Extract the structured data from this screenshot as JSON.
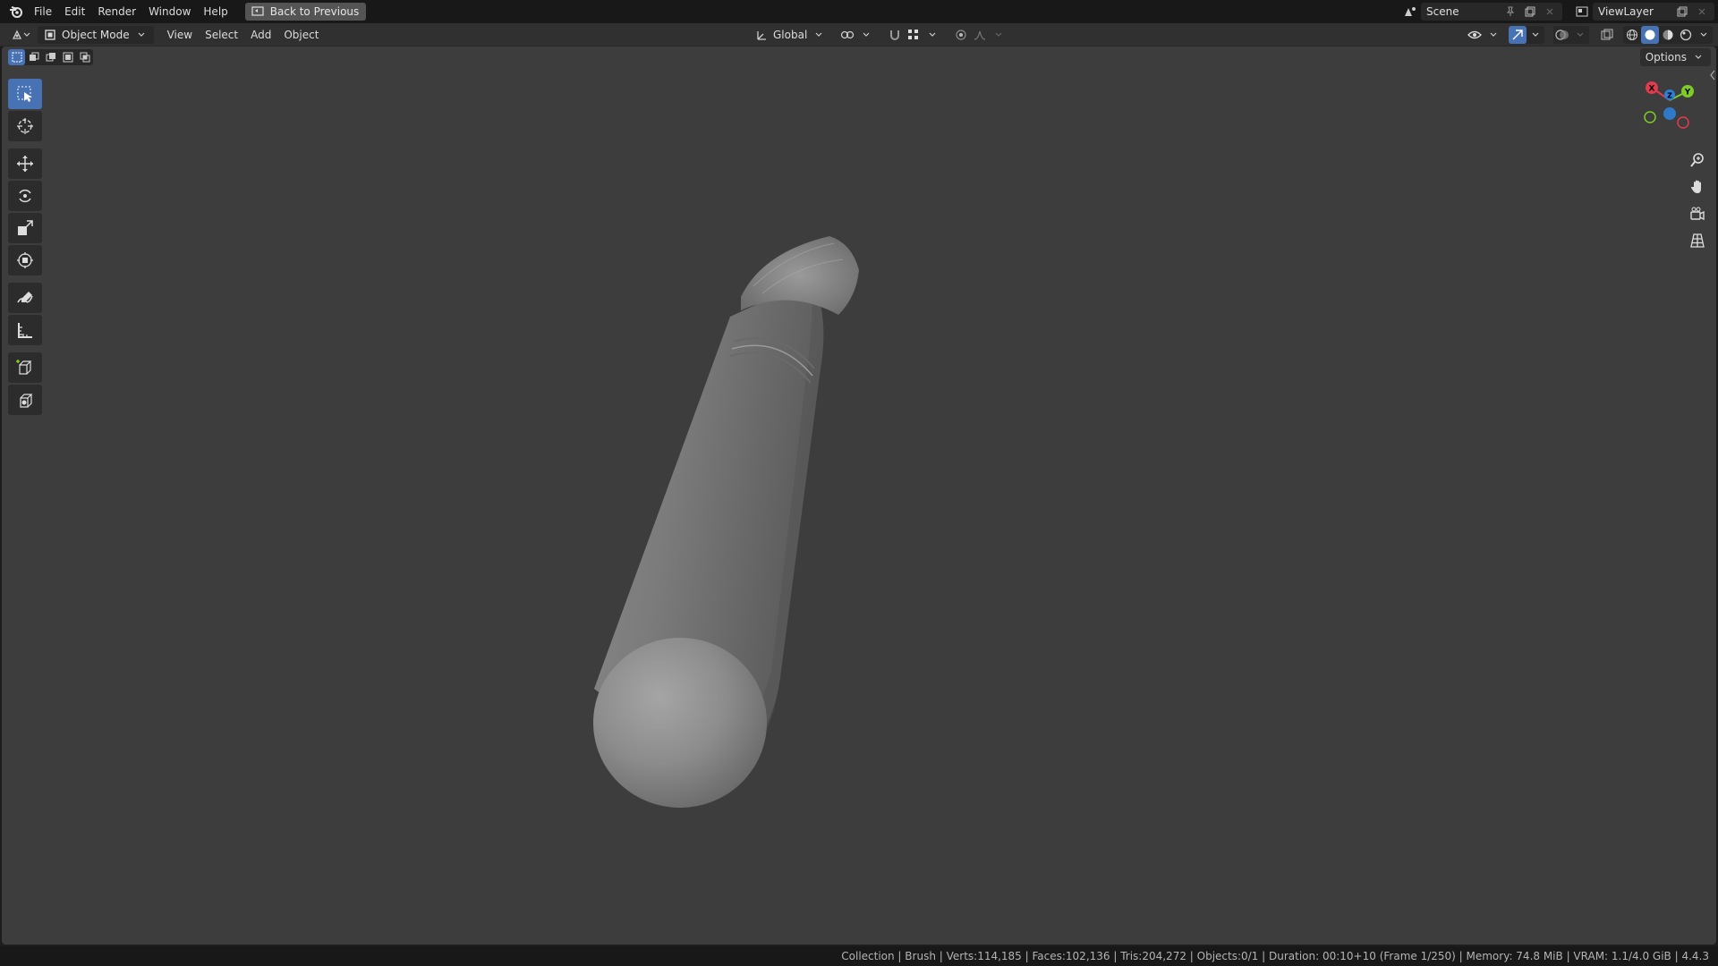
{
  "topbar": {
    "menus": [
      "File",
      "Edit",
      "Render",
      "Window",
      "Help"
    ],
    "back_button": "Back to Previous",
    "scene_name": "Scene",
    "view_layer": "ViewLayer"
  },
  "header": {
    "mode": "Object Mode",
    "menus": [
      "View",
      "Select",
      "Add",
      "Object"
    ],
    "transform_orientation": "Global"
  },
  "viewport": {
    "options_label": "Options",
    "gizmo_axes": [
      "X",
      "Y",
      "Z"
    ]
  },
  "toolbar": {
    "tools": [
      "select-box",
      "cursor",
      "move",
      "rotate",
      "scale",
      "transform",
      "annotate",
      "measure",
      "add-cube",
      "add-primitive"
    ],
    "active_tool": "select-box"
  },
  "statusbar": {
    "text": "Collection | Brush | Verts:114,185 | Faces:102,136 | Tris:204,272 | Objects:0/1 | Duration: 00:10+10 (Frame 1/250) | Memory: 74.8 MiB | VRAM: 1.1/4.0 GiB | 4.4.3"
  },
  "colors": {
    "accent": "#4772b3",
    "viewport_bg": "#3d3d3d",
    "axis_x": "#e23b4e",
    "axis_y": "#7fcc24",
    "axis_z": "#2e7fd8"
  }
}
